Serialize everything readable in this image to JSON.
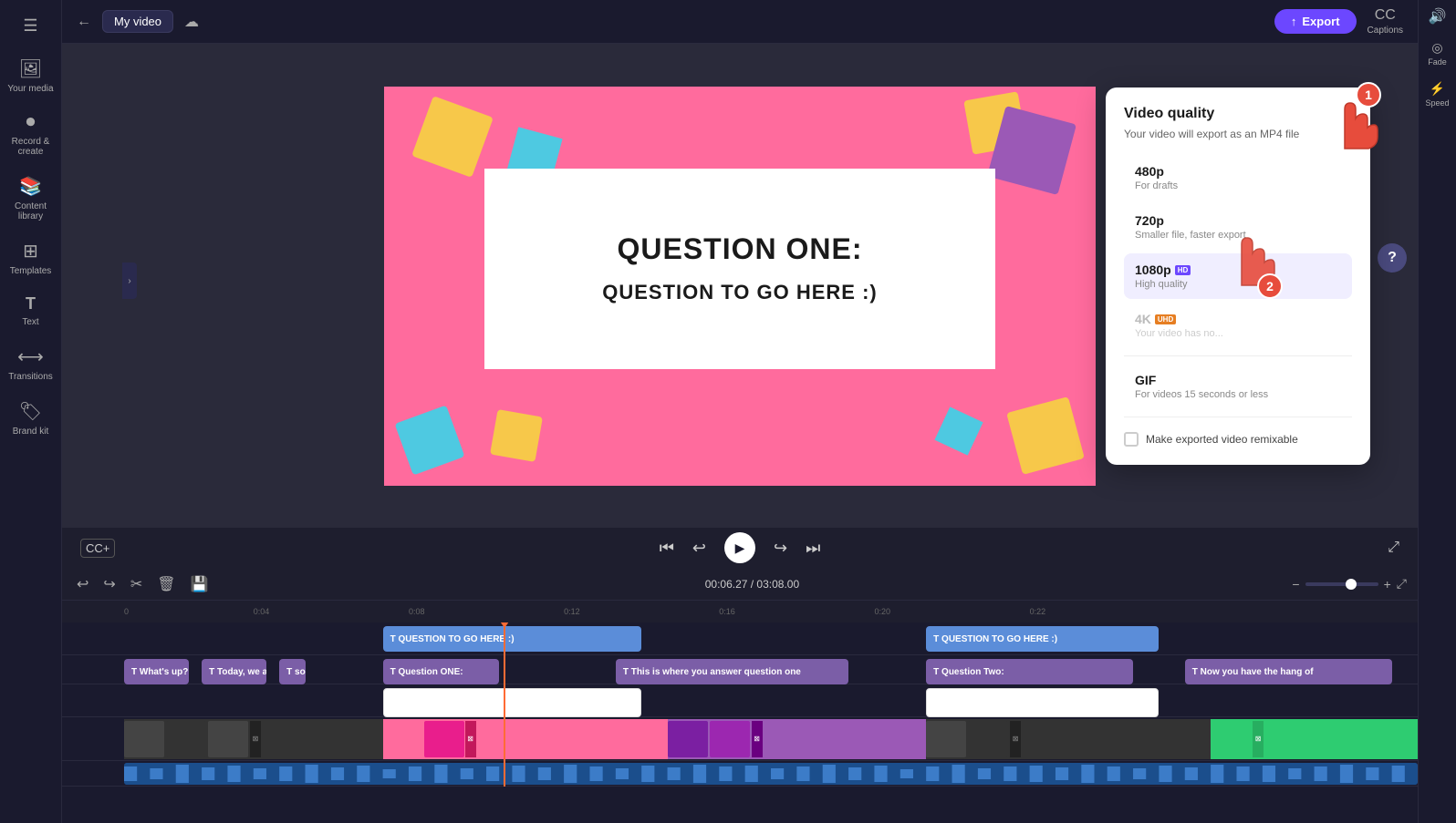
{
  "app": {
    "title": "My video"
  },
  "sidebar": {
    "items": [
      {
        "id": "your-media",
        "label": "Your media",
        "icon": "🖼"
      },
      {
        "id": "record-create",
        "label": "Record & create",
        "icon": "⏺"
      },
      {
        "id": "content-library",
        "label": "Content library",
        "icon": "📚"
      },
      {
        "id": "templates",
        "label": "Templates",
        "icon": "⊞"
      },
      {
        "id": "text",
        "label": "Text",
        "icon": "T"
      },
      {
        "id": "transitions",
        "label": "Transitions",
        "icon": "⟷"
      },
      {
        "id": "brand-kit",
        "label": "Brand kit",
        "icon": "🏷"
      }
    ]
  },
  "topbar": {
    "title": "My video",
    "export_label": "Export",
    "captions_label": "Captions"
  },
  "canvas": {
    "q1": "QUESTION ONE:",
    "q2": "QUESTION TO GO HERE :)"
  },
  "player": {
    "time_current": "00:06.27",
    "time_total": "03:08.00"
  },
  "quality_popup": {
    "title": "Video quality",
    "subtitle": "Your video will export as an MP4 file",
    "options": [
      {
        "id": "480p",
        "label": "480p",
        "badge": "",
        "desc": "For drafts",
        "disabled": false
      },
      {
        "id": "720p",
        "label": "720p",
        "badge": "",
        "desc": "Smaller file, faster export",
        "disabled": false
      },
      {
        "id": "1080p",
        "label": "1080p",
        "badge": "HD",
        "badge_class": "",
        "desc": "High quality",
        "disabled": false,
        "selected": true
      },
      {
        "id": "4k",
        "label": "4K",
        "badge": "UHD",
        "badge_class": "badge-uhd",
        "desc": "Your video has no...",
        "disabled": true
      },
      {
        "id": "gif",
        "label": "GIF",
        "badge": "",
        "desc": "For videos 15 seconds or less",
        "disabled": false
      }
    ],
    "checkbox_label": "Make exported video remixable"
  },
  "timeline": {
    "toolbar": {
      "undo": "↩",
      "redo": "↪",
      "cut": "✂",
      "delete": "🗑",
      "save": "💾"
    },
    "time_display": "00:06.27 / 03:08.00",
    "ruler_marks": [
      "0",
      "0:04",
      "0:08",
      "0:12",
      "0:16",
      "0:20"
    ],
    "tracks": [
      {
        "id": "text-top",
        "clips": [
          {
            "label": "QUESTION TO GO HERE :)",
            "start_pct": 20.5,
            "width_pct": 20,
            "color": "text-blue"
          },
          {
            "label": "QUESTION TO GO HERE :)",
            "start_pct": 62,
            "width_pct": 18,
            "color": "text-blue"
          }
        ]
      },
      {
        "id": "text-mid",
        "clips": [
          {
            "label": "What's up?! W",
            "start_pct": 0,
            "width_pct": 5,
            "color": "text"
          },
          {
            "label": "Today, we a",
            "start_pct": 5.5,
            "width_pct": 5,
            "color": "text"
          },
          {
            "label": "so",
            "start_pct": 11,
            "width_pct": 2,
            "color": "text"
          },
          {
            "label": "Question ONE:",
            "start_pct": 20.5,
            "width_pct": 10,
            "color": "text"
          },
          {
            "label": "This is where you answer question one",
            "start_pct": 38,
            "width_pct": 18,
            "color": "text"
          },
          {
            "label": "Question Two:",
            "start_pct": 62,
            "width_pct": 18,
            "color": "text"
          },
          {
            "label": "Now you have the hang of",
            "start_pct": 83,
            "width_pct": 17,
            "color": "text"
          }
        ]
      },
      {
        "id": "white-clips",
        "clips": [
          {
            "label": "",
            "start_pct": 20.5,
            "width_pct": 20,
            "color": "white"
          },
          {
            "label": "",
            "start_pct": 62,
            "width_pct": 18,
            "color": "white"
          }
        ]
      }
    ]
  }
}
